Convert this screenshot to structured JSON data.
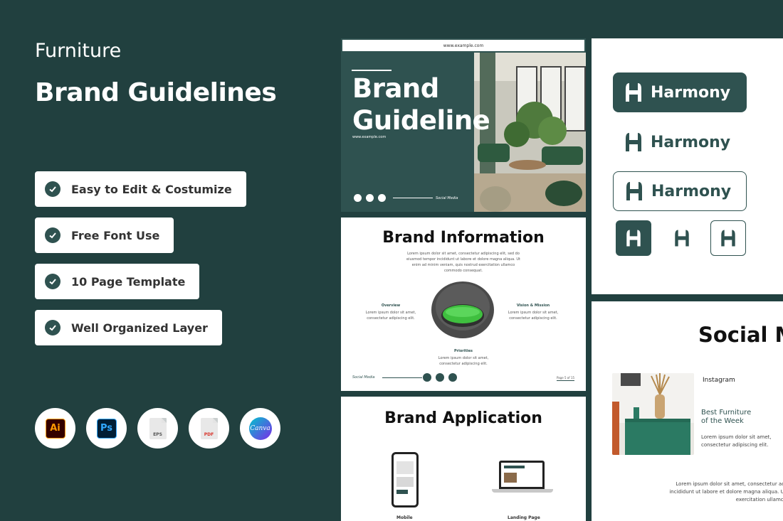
{
  "left": {
    "kicker": "Furniture",
    "title": "Brand Guidelines",
    "features": [
      "Easy to Edit & Costumize",
      "Free Font Use",
      "10 Page Template",
      "Well Organized Layer"
    ],
    "apps": {
      "ai": "Ai",
      "ps": "Ps",
      "eps": "EPS",
      "pdf": "PDF",
      "canva": "Canva"
    }
  },
  "slide1": {
    "url_bar": "www.example.com",
    "title_line1": "Brand",
    "title_line2": "Guideline",
    "url": "www.example.com",
    "social_label": "Social Media"
  },
  "slide2": {
    "title": "Brand Information",
    "lorem": "Lorem ipsum dolor sit amet, consectetur adipiscing elit, sed do eiusmod tempor incididunt ut labore et dolore magna aliqua. Ut enim ad minim veniam, quis nostrud exercitation ullamco commodo consequat.",
    "overview_h": "Overview",
    "overview_t": "Lorem ipsum dolor sit amet, consectetur adipiscing elit.",
    "vision_h": "Vision & Mission",
    "vision_t": "Lorem ipsum dolor sit amet, consectetur adipiscing elit.",
    "priorities_h": "Priorities",
    "priorities_t": "Lorem ipsum dolor sit amet, consectetur adipiscing elit.",
    "footer_label": "Social Media",
    "page": "Page 5 of 15"
  },
  "slide3": {
    "title": "Brand  Application",
    "mobile": "Mobile",
    "landing": "Landing Page"
  },
  "slide4": {
    "brand": "Harmony"
  },
  "slide5": {
    "title": "Social M",
    "platform": "Instagram",
    "sub1": "Best Furniture",
    "sub2": "of the Week",
    "desc1": "Lorem ipsum dolor sit amet,",
    "desc2": "consectetur adipiscing elit.",
    "lorem1": "Lorem ipsum dolor sit amet, consectetur adipi",
    "lorem2": "incididunt ut labore et dolore magna aliqua. Ut e",
    "lorem3": "exercitation ullamco c"
  },
  "colors": {
    "background": "#21403f",
    "brand": "#2f5250",
    "accent_green": "#3fbf3f"
  }
}
